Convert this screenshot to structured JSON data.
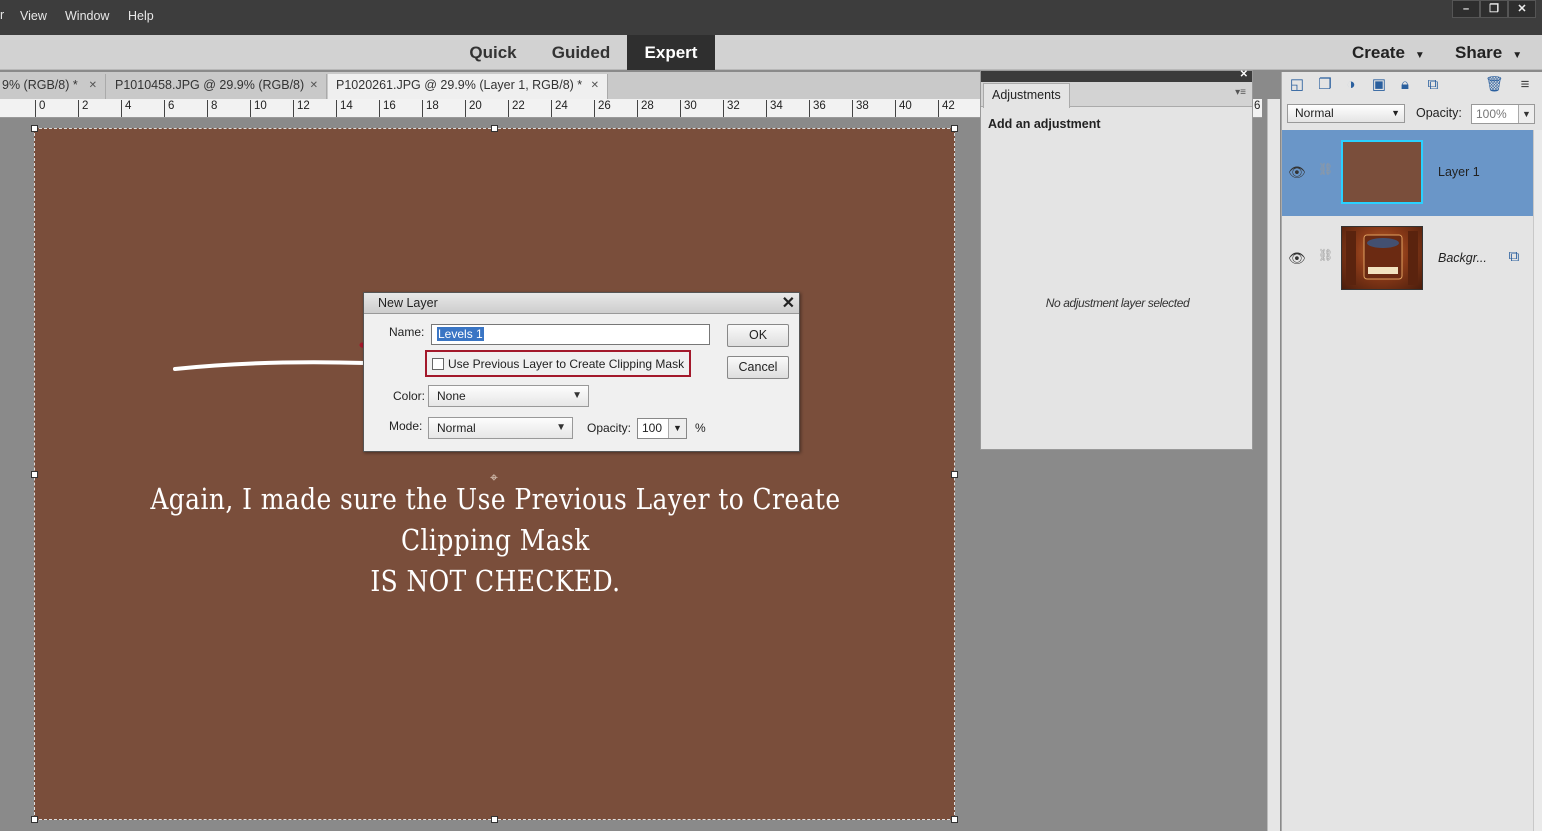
{
  "menu": {
    "items": [
      "View",
      "Window",
      "Help"
    ]
  },
  "window_controls": [
    "–",
    "❐",
    "✕"
  ],
  "modes": {
    "quick": "Quick",
    "guided": "Guided",
    "expert": "Expert",
    "create": "Create",
    "share": "Share"
  },
  "tabs": [
    {
      "label": "9% (RGB/8) *"
    },
    {
      "label": "P1010458.JPG @ 29.9% (RGB/8)"
    },
    {
      "label": "P1020261.JPG @ 29.9% (Layer 1, RGB/8) *"
    }
  ],
  "ruler": {
    "marks": [
      "0",
      "2",
      "4",
      "6",
      "8",
      "10",
      "12",
      "14",
      "16",
      "18",
      "20",
      "22",
      "24",
      "26",
      "28",
      "30",
      "32",
      "34",
      "36",
      "38",
      "40",
      "42",
      "6"
    ]
  },
  "canvas": {
    "fill_color": "#7a4e3b",
    "caption_line1": "Again, I made sure the Use Previous Layer to Create Clipping Mask",
    "caption_line2": "IS NOT CHECKED."
  },
  "dialog": {
    "title": "New Layer",
    "name_label": "Name:",
    "name_value": "Levels 1",
    "clip_label": "Use Previous Layer to Create Clipping Mask",
    "clip_checked": false,
    "color_label": "Color:",
    "color_value": "None",
    "mode_label": "Mode:",
    "mode_value": "Normal",
    "opacity_label": "Opacity:",
    "opacity_value": "100",
    "opacity_unit": "%",
    "ok": "OK",
    "cancel": "Cancel"
  },
  "adjustments": {
    "tab": "Adjustments",
    "heading": "Add an adjustment",
    "empty_message": "No adjustment layer selected"
  },
  "layers": {
    "blend_mode": "Normal",
    "opacity_label": "Opacity:",
    "opacity_value": "100%",
    "items": [
      {
        "name": "Layer 1",
        "selected": true
      },
      {
        "name": "Backgr...",
        "selected": false
      }
    ]
  }
}
